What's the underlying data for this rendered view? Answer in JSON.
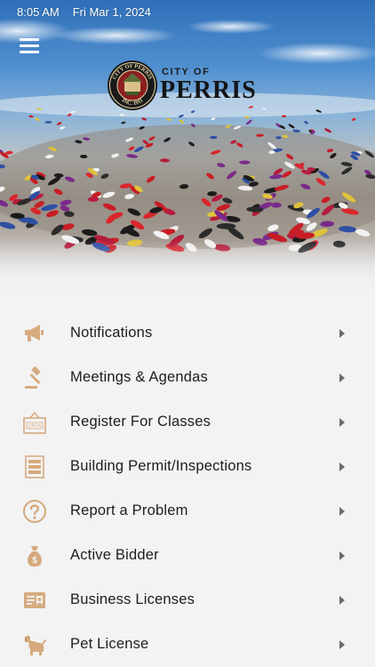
{
  "status_bar": {
    "time": "8:05 AM",
    "date": "Fri Mar 1, 2024"
  },
  "header": {
    "menu_icon": "hamburger-menu-icon",
    "logo": {
      "prefix": "CITY OF",
      "name": "PERRIS",
      "seal_top": "CITY OF PERRIS",
      "seal_bottom": "INC. 1911"
    }
  },
  "theme": {
    "icon_color": "#d6aa7e",
    "chevron_color": "#6c6c6c",
    "text_color": "#1d1d1f",
    "background": "#f3f3f4"
  },
  "menu": {
    "items": [
      {
        "label": "Notifications",
        "icon": "megaphone-icon"
      },
      {
        "label": "Meetings & Agendas",
        "icon": "gavel-icon"
      },
      {
        "label": "Register For Classes",
        "icon": "open-sign-icon"
      },
      {
        "label": "Building Permit/Inspections",
        "icon": "document-stack-icon"
      },
      {
        "label": "Report a Problem",
        "icon": "question-circle-icon"
      },
      {
        "label": "Active Bidder",
        "icon": "money-bag-icon"
      },
      {
        "label": "Business Licenses",
        "icon": "license-card-icon"
      },
      {
        "label": "Pet License",
        "icon": "dog-icon"
      }
    ]
  }
}
